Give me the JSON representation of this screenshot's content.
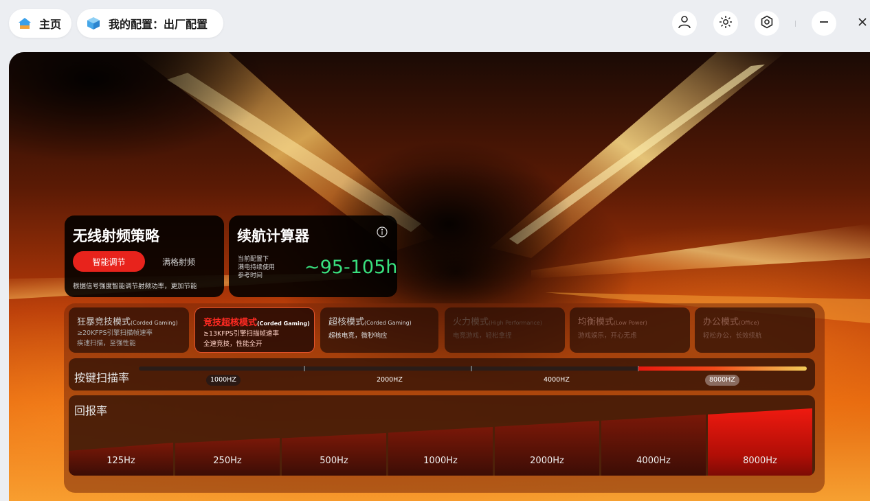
{
  "nav": {
    "home_label": "主页",
    "config_label": "我的配置：出厂配置"
  },
  "colors": {
    "accent_red": "#e8231c",
    "battery_green": "#39e07e",
    "home_icon": "#3aa0ea",
    "config_icon": "#45a6e8"
  },
  "icons": [
    "home-icon",
    "cube-icon",
    "user-icon",
    "brightness-icon",
    "settings-icon",
    "minimize-icon",
    "close-icon",
    "info-icon"
  ],
  "wireless": {
    "title": "无线射频策略",
    "option_active": "智能调节",
    "option_inactive": "满格射频",
    "description": "根据信号强度智能调节射频功率，更加节能"
  },
  "battery": {
    "title": "续航计算器",
    "note_line1": "当前配置下",
    "note_line2": "满电持续使用",
    "note_line3": "参考时间",
    "value": "~95-105h"
  },
  "modes": [
    {
      "title": "狂暴竞技模式",
      "tag": "(Corded Gaming)",
      "line1": "≥20KFPS引擎扫描帧速率",
      "line2": "疾速扫描，至强性能"
    },
    {
      "title": "竞技超核模式",
      "tag": "(Corded Gaming)",
      "line1": "≥13KFPS引擎扫描帧速率",
      "line2": "全速竞技，性能全开"
    },
    {
      "title": "超核模式",
      "tag": "(Corded Gaming)",
      "line1": "超核电竞，微秒响应"
    },
    {
      "title": "火力模式",
      "tag": "(High Performance)",
      "line1": "电竞游戏，轻松拿捏"
    },
    {
      "title": "均衡模式",
      "tag": "(Low Power)",
      "line1": "游戏娱乐，开心无虑"
    },
    {
      "title": "办公模式",
      "tag": "(Office)",
      "line1": "轻松办公，长效续航"
    }
  ],
  "active_mode": 1,
  "scan_rate": {
    "label": "按键扫描率",
    "options": [
      "1000HZ",
      "2000HZ",
      "4000HZ",
      "8000HZ"
    ],
    "selected": "8000HZ"
  },
  "report_rate": {
    "label": "回报率",
    "options": [
      "125Hz",
      "250Hz",
      "500Hz",
      "1000Hz",
      "2000Hz",
      "4000Hz",
      "8000Hz"
    ],
    "selected": "8000Hz"
  }
}
